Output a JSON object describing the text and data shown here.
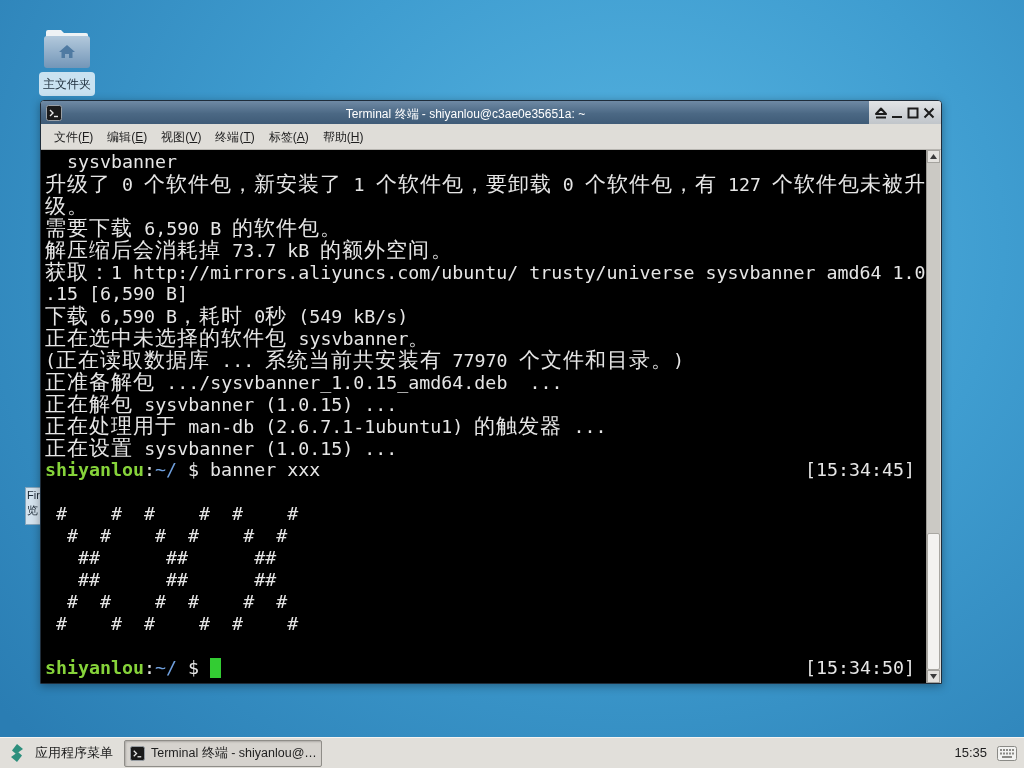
{
  "desktop": {
    "icons": [
      {
        "label": "主文件夹",
        "selected": true
      }
    ],
    "background_window": {
      "lines": [
        "Fir",
        "览"
      ]
    }
  },
  "window": {
    "title": "Terminal 终端 - shiyanlou@c3ae0e35651a: ~",
    "menu": [
      {
        "label_start": "文件(",
        "accel": "F",
        "label_end": ")"
      },
      {
        "label_start": "编辑(",
        "accel": "E",
        "label_end": ")"
      },
      {
        "label_start": "视图(",
        "accel": "V",
        "label_end": ")"
      },
      {
        "label_start": "终端(",
        "accel": "T",
        "label_end": ")"
      },
      {
        "label_start": "标签(",
        "accel": "A",
        "label_end": ")"
      },
      {
        "label_start": "帮助(",
        "accel": "H",
        "label_end": ")"
      }
    ]
  },
  "terminal": {
    "lines": [
      {
        "kind": "output",
        "text": "  sysvbanner"
      },
      {
        "kind": "output",
        "text": "升级了 0 个软件包，新安装了 1 个软件包，要卸载 0 个软件包，有 127 个软件包未被升"
      },
      {
        "kind": "output",
        "text": "级。"
      },
      {
        "kind": "output",
        "text": "需要下载 6,590 B 的软件包。"
      },
      {
        "kind": "output",
        "text": "解压缩后会消耗掉 73.7 kB 的额外空间。"
      },
      {
        "kind": "output",
        "text": "获取：1 http://mirrors.aliyuncs.com/ubuntu/ trusty/universe sysvbanner amd64 1.0"
      },
      {
        "kind": "output",
        "text": ".15 [6,590 B]"
      },
      {
        "kind": "output",
        "text": "下载 6,590 B，耗时 0秒 (549 kB/s)"
      },
      {
        "kind": "output",
        "text": "正在选中未选择的软件包 sysvbanner。"
      },
      {
        "kind": "output",
        "text": "(正在读取数据库 ... 系统当前共安装有 77970 个文件和目录。)"
      },
      {
        "kind": "output",
        "text": "正准备解包 .../sysvbanner_1.0.15_amd64.deb  ..."
      },
      {
        "kind": "output",
        "text": "正在解包 sysvbanner (1.0.15) ..."
      },
      {
        "kind": "output",
        "text": "正在处理用于 man-db (2.6.7.1-1ubuntu1) 的触发器 ..."
      },
      {
        "kind": "output",
        "text": "正在设置 sysvbanner (1.0.15) ..."
      },
      {
        "kind": "prompt",
        "user": "shiyanlou",
        "separator": ":",
        "path": "~/",
        "symbol": "$",
        "command": "banner xxx",
        "time": "[15:34:45]",
        "cursor": false
      },
      {
        "kind": "blank"
      },
      {
        "kind": "output",
        "text": " #    #  #    #  #    #"
      },
      {
        "kind": "output",
        "text": "  #  #    #  #    #  #"
      },
      {
        "kind": "output",
        "text": "   ##      ##      ##"
      },
      {
        "kind": "output",
        "text": "   ##      ##      ##"
      },
      {
        "kind": "output",
        "text": "  #  #    #  #    #  #"
      },
      {
        "kind": "output",
        "text": " #    #  #    #  #    #"
      },
      {
        "kind": "blank"
      },
      {
        "kind": "prompt",
        "user": "shiyanlou",
        "separator": ":",
        "path": "~/",
        "symbol": "$",
        "time": "[15:34:50]",
        "cursor": true
      }
    ]
  },
  "taskbar": {
    "menu_button": {
      "label": "应用程序菜单"
    },
    "tasks": [
      {
        "label": "Terminal 终端 - shiyanlou@…",
        "selected": true
      }
    ],
    "clock": "15:35"
  }
}
